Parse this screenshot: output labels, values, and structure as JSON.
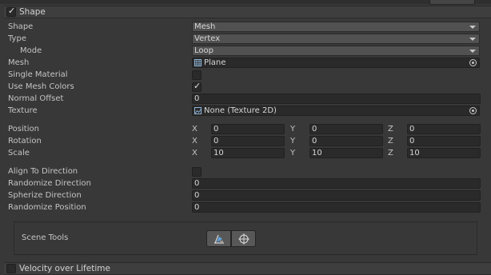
{
  "shape_module": {
    "title": "Shape",
    "enabled": true,
    "shape": {
      "label": "Shape",
      "value": "Mesh"
    },
    "type": {
      "label": "Type",
      "value": "Vertex"
    },
    "mode": {
      "label": "Mode",
      "value": "Loop"
    },
    "mesh": {
      "label": "Mesh",
      "value": "Plane",
      "icon": "mesh-icon"
    },
    "single_material": {
      "label": "Single Material",
      "checked": false
    },
    "use_mesh_colors": {
      "label": "Use Mesh Colors",
      "checked": true
    },
    "normal_offset": {
      "label": "Normal Offset",
      "value": "0"
    },
    "texture": {
      "label": "Texture",
      "value": "None (Texture 2D)",
      "icon": "texture-icon"
    },
    "position": {
      "label": "Position",
      "x": "0",
      "y": "0",
      "z": "0"
    },
    "rotation": {
      "label": "Rotation",
      "x": "0",
      "y": "0",
      "z": "0"
    },
    "scale": {
      "label": "Scale",
      "x": "10",
      "y": "10",
      "z": "10"
    },
    "axis_labels": {
      "x": "X",
      "y": "Y",
      "z": "Z"
    },
    "align_to_direction": {
      "label": "Align To Direction",
      "checked": false
    },
    "randomize_direction": {
      "label": "Randomize Direction",
      "value": "0"
    },
    "spherize_direction": {
      "label": "Spherize Direction",
      "value": "0"
    },
    "randomize_position": {
      "label": "Randomize Position",
      "value": "0"
    },
    "scene_tools": {
      "label": "Scene Tools",
      "tools": [
        "edit-shape-icon",
        "transform-gizmo-icon"
      ]
    }
  },
  "velocity_module": {
    "title": "Velocity over Lifetime",
    "enabled": false
  },
  "colors": {
    "panel_bg": "#383838",
    "field_bg": "#2a2a2a",
    "dropdown_bg": "#515151",
    "text": "#c4c4c4"
  }
}
